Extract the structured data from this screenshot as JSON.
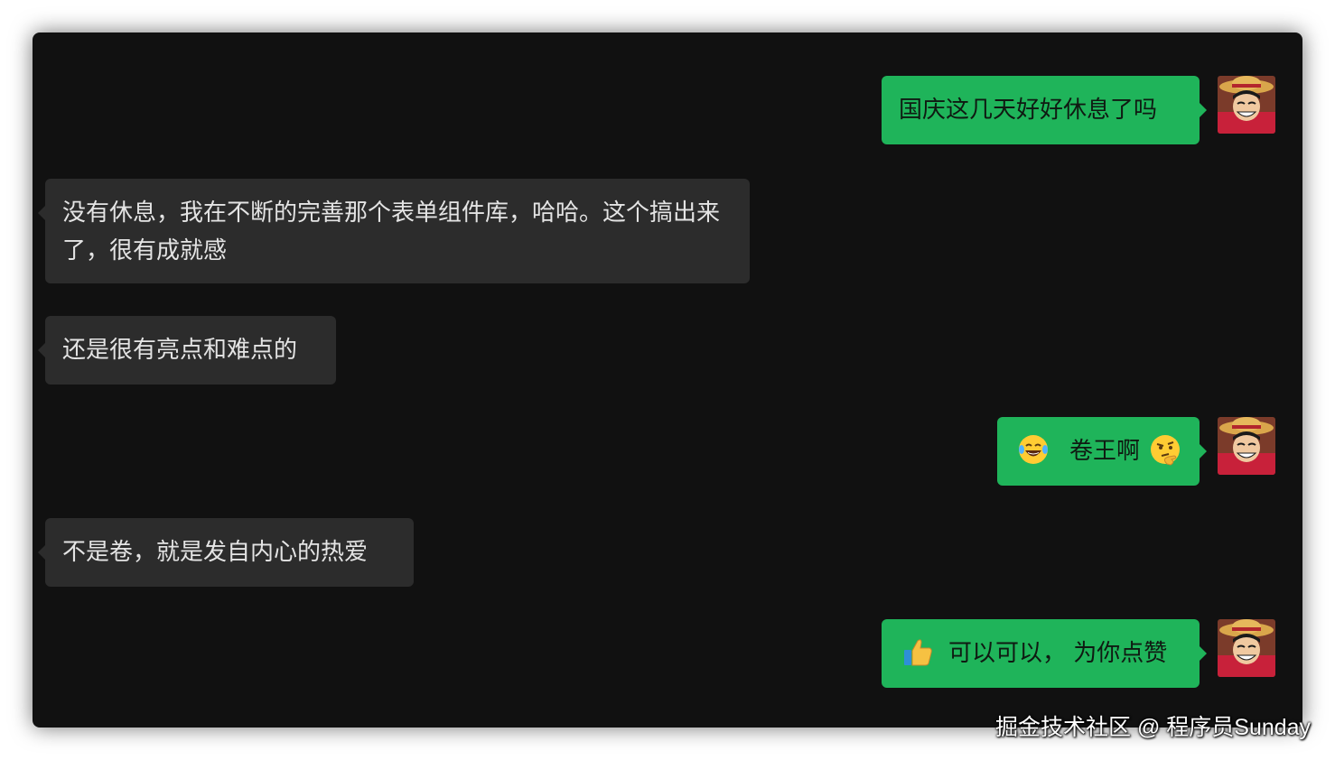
{
  "messages": [
    {
      "side": "right",
      "text": "国庆这几天好好休息了吗"
    },
    {
      "side": "left",
      "text": "没有休息，我在不断的完善那个表单组件库，哈哈。这个搞出来了，很有成就感"
    },
    {
      "side": "left",
      "text": "还是很有亮点和难点的"
    },
    {
      "side": "right",
      "text": "卷王啊",
      "emoji_before": "laughing-tears-emoji",
      "emoji_after": "thinking-face-emoji"
    },
    {
      "side": "left",
      "text": "不是卷，就是发自内心的热爱"
    },
    {
      "side": "right",
      "text": "可以可以， 为你点赞",
      "emoji_before": "thumbs-up-emoji"
    }
  ],
  "avatar": {
    "icon": "straw-hat-character-avatar"
  },
  "watermark": "掘金技术社区 @ 程序员Sunday",
  "colors": {
    "background": "#111111",
    "right_bubble": "#1fb45a",
    "left_bubble": "#2c2c2c",
    "left_text": "#e4e4e4"
  }
}
